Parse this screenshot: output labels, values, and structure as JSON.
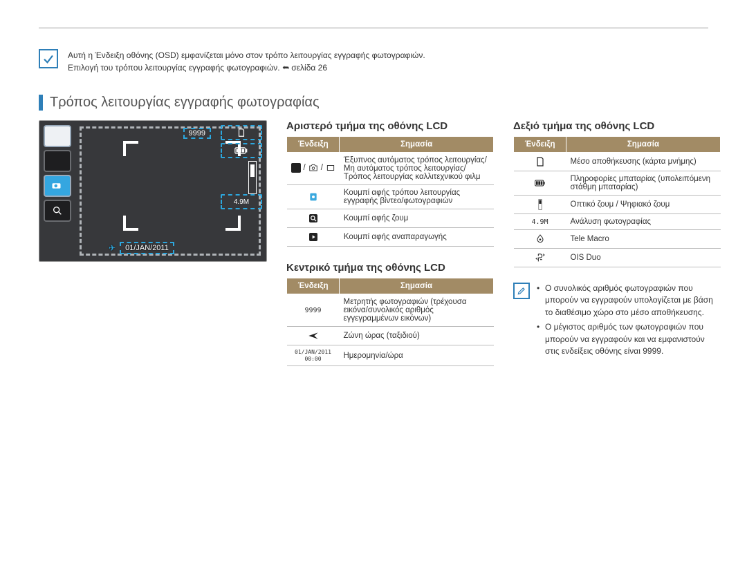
{
  "topNote": {
    "line1": "Αυτή η Ένδειξη οθόνης (OSD) εμφανίζεται μόνο στον τρόπο λειτουργίας εγγραφής φωτογραφιών.",
    "line2a": "Επιλογή του τρόπου λειτουργίας εγγραφής φωτογραφιών. ",
    "line2b": "σελίδα 26"
  },
  "sectionTitle": "Τρόπος λειτουργίας εγγραφής φωτογραφίας",
  "lcd": {
    "count": "9999",
    "resolution": "4.9M",
    "dateOverlay": "01/JAN/2011"
  },
  "leftTable": {
    "heading": "Αριστερό τμήμα της οθόνης LCD",
    "hdrIndicator": "Ένδειξη",
    "hdrMeaning": "Σημασία",
    "rows": [
      {
        "meaning": "Έξυπνος αυτόματος τρόπος λειτουργίας/Μη αυτόματος τρόπος λειτουργίας/Τρόπος λειτουργίας καλλιτεχνικού φιλμ"
      },
      {
        "meaning": "Κουμπί αφής τρόπου λειτουργίας εγγραφής βίντεο/φωτογραφιών"
      },
      {
        "meaning": "Κουμπί αφής ζουμ"
      },
      {
        "meaning": "Κουμπί αφής αναπαραγωγής"
      }
    ]
  },
  "centerTable": {
    "heading": "Κεντρικό τμήμα της οθόνης LCD",
    "hdrIndicator": "Ένδειξη",
    "hdrMeaning": "Σημασία",
    "rows": [
      {
        "indicator": "9999",
        "meaning": "Μετρητής φωτογραφιών (τρέχουσα εικόνα/συνολικός αριθμός εγγεγραμμένων εικόνων)"
      },
      {
        "indicator": "",
        "meaning": "Ζώνη ώρας (ταξιδιού)"
      },
      {
        "indicator": "01/JAN/2011\n00:00",
        "meaning": "Ημερομηνία/ώρα"
      }
    ]
  },
  "rightTable": {
    "heading": "Δεξιό τμήμα της οθόνης LCD",
    "hdrIndicator": "Ένδειξη",
    "hdrMeaning": "Σημασία",
    "rows": [
      {
        "meaning": "Μέσο αποθήκευσης (κάρτα μνήμης)"
      },
      {
        "meaning": "Πληροφορίες μπαταρίας (υπολειπόμενη στάθμη μπαταρίας)"
      },
      {
        "meaning": "Οπτικό ζουμ / Ψηφιακό ζουμ"
      },
      {
        "indicator": "4.9M",
        "meaning": "Ανάλυση φωτογραφίας"
      },
      {
        "meaning": "Tele Macro"
      },
      {
        "meaning": "OIS Duo"
      }
    ]
  },
  "rightNote": {
    "item1": "Ο συνολικός αριθμός φωτογραφιών που μπορούν να εγγραφούν υπολογίζεται με βάση το διαθέσιμο χώρο στο μέσο αποθήκευσης.",
    "item2": "Ο μέγιστος αριθμός των φωτογραφιών που μπορούν να εγγραφούν και να εμφανιστούν στις ενδείξεις οθόνης είναι 9999."
  }
}
